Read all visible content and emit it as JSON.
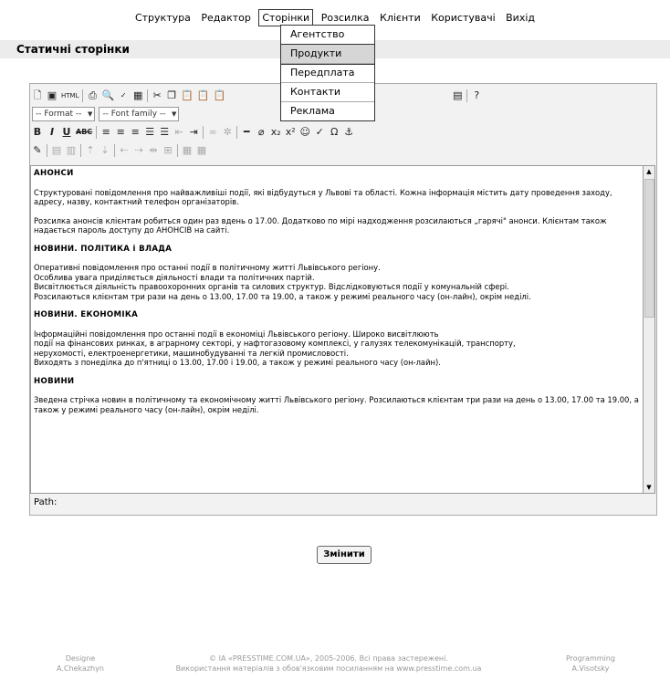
{
  "nav": {
    "items": [
      "Структура",
      "Редактор",
      "Сторінки",
      "Розсилка",
      "Клієнти",
      "Користувачі",
      "Вихід"
    ],
    "active_index": 2
  },
  "dropdown": {
    "items": [
      "Агентство",
      "Продукти",
      "Передплата",
      "Контакти",
      "Реклама"
    ],
    "selected_index": 1
  },
  "section_title": "Статичні сторінки",
  "editor": {
    "format_select": "-- Format --",
    "font_select": "-- Font family --",
    "toolbar_row1": [
      "new-document-icon",
      "save-icon",
      "html-icon",
      "print-icon",
      "preview-icon",
      "spellcheck-icon",
      "table-icon",
      "cut-icon",
      "copy-icon",
      "paste-icon",
      "paste-text-icon",
      "paste-word-icon"
    ],
    "toolbar_row1_right": [
      "fullscreen-icon",
      "help-icon"
    ],
    "path_label": "Path:",
    "content": {
      "h1": "АНОНСИ",
      "p1": "Структуровані повідомлення про найважливіші події, які відбудуться у Львові та області. Кожна інформація містить дату проведення заходу, адресу, назву, контактний телефон організаторів.",
      "p2": "Розсилка анонсів клієнтам робиться один раз вдень о 17.00. Додатково по мірі надходження розсилаються „гарячі\" анонси. Клієнтам також надається пароль доступу до АНОНСІВ на сайті.",
      "h2": "НОВИНИ. ПОЛІТИКА і ВЛАДА",
      "p3a": "Оперативні повідомлення про останні події в політичному житті Львівського регіону.",
      "p3b": "Особлива увага приділяється діяльності влади та політичних партій.",
      "p3c": "Висвітлюється діяльність правоохоронних органів та силових структур. Відслідковуються події у комунальній сфері.",
      "p3d": "Розсилаються клієнтам три рази на день о 13.00,  17.00 та 19.00, а також у режимі реального часу (он-лайн), окрім неділі.",
      "h3": "НОВИНИ. ЕКОНОМІКА",
      "p4a": "Інформаційні повідомлення про останні події в економіці Львівського регіону. Широко висвітлюють",
      "p4b": "події на фінансових ринках, в аграрному секторі, у нафтогазовому комплексі, у галузях телекомунікацій, транспорту,",
      "p4c": "нерухомості, електроенергетики, машинобудуванні та  легкій промисловості.",
      "p4d": "Виходять з понеділка до п'ятниці о 13.00, 17.00 і 19.00, а також у режимі реального часу (он-лайн).",
      "h4": "НОВИНИ",
      "p5": "Зведена стрічка новин в політичному та економічному житті Львівського регіону. Розсилаються клієнтам три рази на день о 13.00,  17.00 та 19.00, а також у режимі реального часу (он-лайн), окрім неділі."
    }
  },
  "save_button": "Змінити",
  "footer": {
    "left_line1": "Designe",
    "left_line2": "A.Chekazhyn",
    "center_line1": "© ІА «PRESSTIME.COM.UA», 2005-2006. Всі права застережені.",
    "center_line2": "Використання матеріалів з обов'язковим посиланням на www.presstime.com.ua",
    "right_line1": "Programming",
    "right_line2": "A.Visotsky"
  }
}
